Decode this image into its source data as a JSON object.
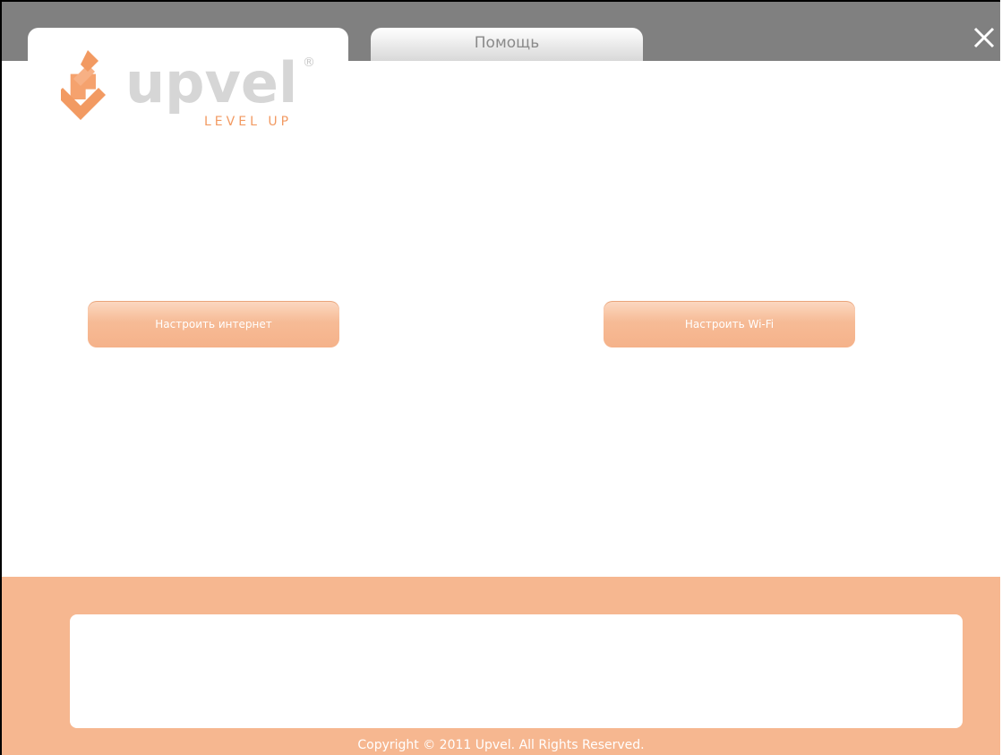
{
  "tabs": {
    "active_label": "",
    "help_label": "Помощь"
  },
  "logo": {
    "brand_text": "upvel",
    "tagline": "LEVEL UP",
    "registered_mark": "®"
  },
  "buttons": {
    "setup_internet": "Настроить интернет",
    "setup_wifi": "Настроить Wi-Fi"
  },
  "message_box": {
    "text": ""
  },
  "footer": {
    "copyright": "Copyright © 2011 Upvel. All Rights Reserved."
  },
  "colors": {
    "accent": "#f6b790",
    "topbar": "#808080",
    "button": "#f5b28a"
  },
  "icons": {
    "close": "close-icon",
    "logo": "upvel-logo-icon"
  }
}
